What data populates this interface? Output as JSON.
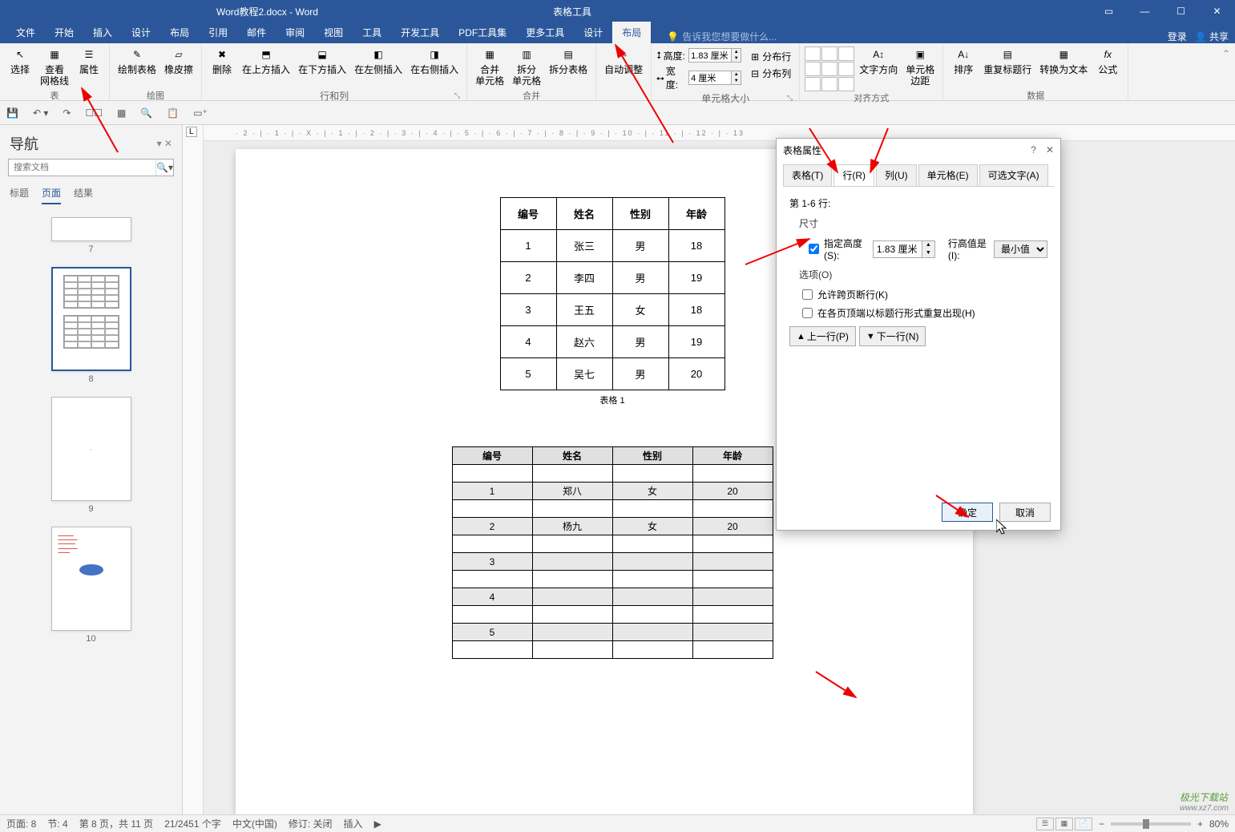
{
  "titlebar": {
    "doc_title": "Word教程2.docx - Word",
    "tools_title": "表格工具"
  },
  "ribbon_tabs": [
    "文件",
    "开始",
    "插入",
    "设计",
    "布局",
    "引用",
    "邮件",
    "审阅",
    "视图",
    "工具",
    "开发工具",
    "PDF工具集",
    "更多工具"
  ],
  "tool_tabs": [
    "设计",
    "布局"
  ],
  "tellme": "告诉我您想要做什么...",
  "account": {
    "login": "登录",
    "share": "共享"
  },
  "ribbon": {
    "group_table": {
      "label": "表",
      "select": "选择",
      "view_gridlines": "查看\n网格线",
      "properties": "属性"
    },
    "group_draw": {
      "label": "绘图",
      "draw_table": "绘制表格",
      "eraser": "橡皮擦"
    },
    "group_rowcol": {
      "label": "行和列",
      "delete": "删除",
      "insert_above": "在上方插入",
      "insert_below": "在下方插入",
      "insert_left": "在左侧插入",
      "insert_right": "在右侧插入"
    },
    "group_merge": {
      "label": "合并",
      "merge_cells": "合并\n单元格",
      "split_cells": "拆分\n单元格",
      "split_table": "拆分表格"
    },
    "group_autofit": {
      "label": "",
      "autofit": "自动调整"
    },
    "group_cellsize": {
      "label": "单元格大小",
      "height_lbl": "高度:",
      "width_lbl": "宽度:",
      "height_val": "1.83 厘米",
      "width_val": "4 厘米",
      "dist_rows": "分布行",
      "dist_cols": "分布列"
    },
    "group_align": {
      "label": "对齐方式",
      "text_dir": "文字方向",
      "cell_margins": "单元格\n边距"
    },
    "group_data": {
      "label": "数据",
      "sort": "排序",
      "repeat_header": "重复标题行",
      "convert_text": "转换为文本",
      "formula": "公式"
    }
  },
  "nav": {
    "title": "导航",
    "search_placeholder": "搜索文档",
    "tabs": [
      "标题",
      "页面",
      "结果"
    ],
    "pages": [
      "7",
      "8",
      "9",
      "10"
    ]
  },
  "ruler_h": "· 2 · | · 1 · | · X · | · 1 · | · 2 · | · 3 · | · 4 · | · 5 · | · 6 · | · 7 · | · 8 · | · 9 · | · 10 · | · 11 · | · 12 · | · 13",
  "doc": {
    "table1": {
      "headers": [
        "编号",
        "姓名",
        "性别",
        "年龄"
      ],
      "rows": [
        [
          "1",
          "张三",
          "男",
          "18"
        ],
        [
          "2",
          "李四",
          "男",
          "19"
        ],
        [
          "3",
          "王五",
          "女",
          "18"
        ],
        [
          "4",
          "赵六",
          "男",
          "19"
        ],
        [
          "5",
          "吴七",
          "男",
          "20"
        ]
      ],
      "caption": "表格 1"
    },
    "table2": {
      "headers": [
        "编号",
        "姓名",
        "性别",
        "年龄"
      ],
      "rows": [
        [
          "1",
          "郑八",
          "女",
          "20"
        ],
        [
          "2",
          "杨九",
          "女",
          "20"
        ],
        [
          "3",
          "",
          "",
          ""
        ],
        [
          "4",
          "",
          "",
          ""
        ],
        [
          "5",
          "",
          "",
          ""
        ]
      ]
    }
  },
  "dialog": {
    "title": "表格属性",
    "tabs": [
      "表格(T)",
      "行(R)",
      "列(U)",
      "单元格(E)",
      "可选文字(A)"
    ],
    "rows_label": "第 1-6 行:",
    "size_label": "尺寸",
    "specify_height": "指定高度(S):",
    "height_val": "1.83 厘米",
    "height_is": "行高值是(I):",
    "height_type": "最小值",
    "options_label": "选项(O)",
    "allow_break": "允许跨页断行(K)",
    "repeat_header": "在各页顶端以标题行形式重复出现(H)",
    "prev_row": "上一行(P)",
    "next_row": "下一行(N)",
    "ok": "确定",
    "cancel": "取消"
  },
  "status": {
    "page": "页面: 8",
    "section": "节: 4",
    "page_of": "第 8 页，共 11 页",
    "words": "21/2451 个字",
    "lang": "中文(中国)",
    "track": "修订: 关闭",
    "insert": "插入",
    "zoom": "80%"
  },
  "watermark": {
    "name": "极光下载站",
    "url": "www.xz7.com"
  }
}
